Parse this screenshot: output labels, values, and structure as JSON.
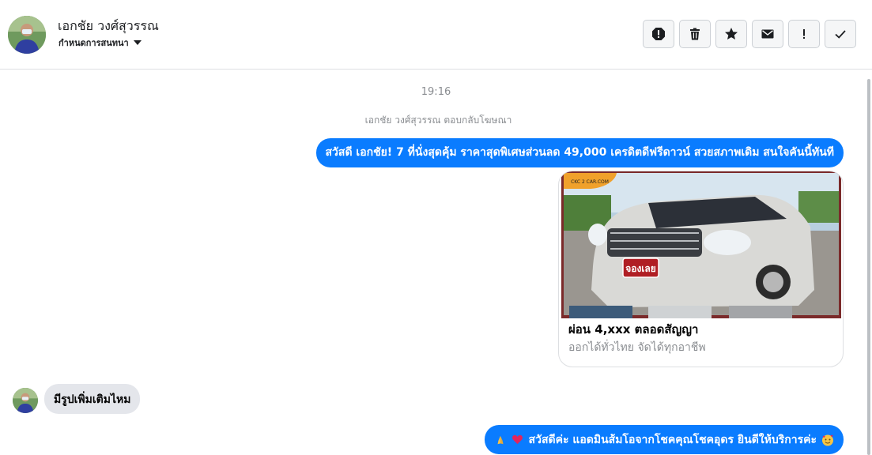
{
  "header": {
    "contact_name": "เอกชัย วงศ์สุวรรณ",
    "assign_label": "กำหนดการสนทนา",
    "actions": [
      {
        "name": "report-icon",
        "label": "report"
      },
      {
        "name": "trash-icon",
        "label": "delete"
      },
      {
        "name": "star-icon",
        "label": "star"
      },
      {
        "name": "envelope-icon",
        "label": "mark unread"
      },
      {
        "name": "exclamation-icon",
        "label": "important"
      },
      {
        "name": "check-icon",
        "label": "done"
      }
    ]
  },
  "chat": {
    "timestamp": "19:16",
    "ad_reply_notice": "เอกชัย วงศ์สุวรรณ ตอบกลับโฆษณา",
    "messages": [
      {
        "direction": "outgoing",
        "text": "สวัสดี เอกชัย! 7 ที่นั่งสุดคุ้ม ราคาสุดพิเศษส่วนลด 49,000 เครดิตดีฟรีดาวน์ สวยสภาพเดิม สนใจคันนี้ทันที"
      },
      {
        "direction": "outgoing",
        "type": "ad_card",
        "title": "ผ่อน 4,xxx ตลอดสัญญา",
        "subtitle": "ออกได้ทั่วไทย จัดได้ทุกอาชีพ",
        "image_badge": "จองเลย",
        "image_logo": "CKC 2 CAR.COM"
      },
      {
        "direction": "incoming",
        "text": "มีรูปเพิ่มเติมไหม"
      },
      {
        "direction": "outgoing",
        "text": "สวัสดีค่ะ แอดมินส้มโอจากโชคคุณโชคอุดร ยินดีให้บริการค่ะ",
        "emoji_before": [
          "pray-emoji",
          "heart-emoji"
        ],
        "emoji_after": [
          "smiling-face-hearts-emoji"
        ]
      }
    ]
  },
  "colors": {
    "outgoing_bubble": "#0a7cff",
    "incoming_bubble": "#e4e6eb"
  }
}
